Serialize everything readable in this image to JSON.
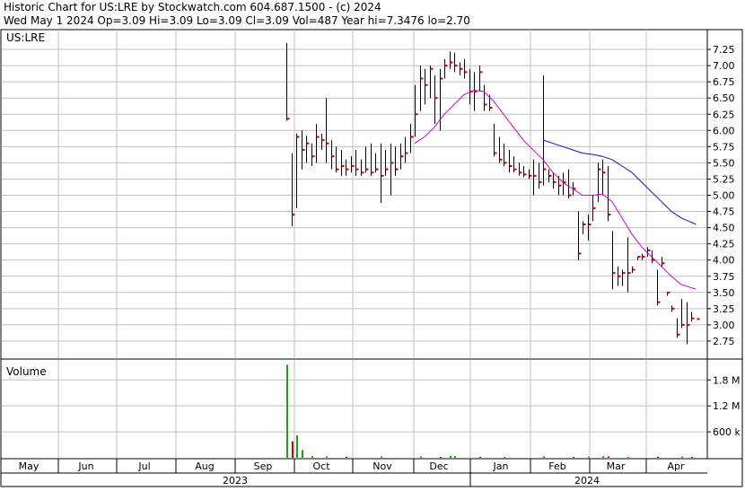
{
  "header": {
    "line1": "Historic Chart for US:LRE by Stockwatch.com 604.687.1500 - (c) 2024",
    "line2": "Wed May  1 2024  Op=3.09  Hi=3.09  Lo=3.09  Cl=3.09  Vol=487  Year hi=7.3476  lo=2.70"
  },
  "colors": {
    "price_bar": "#000000",
    "close_tick": "#cc0000",
    "ma_short": "#d000d0",
    "ma_long": "#1010c0",
    "volume_bar": "#11aa11",
    "volume_bar_down": "#cc0000",
    "grid": "#c0c0c0"
  },
  "chart_data": [
    {
      "type": "ohlc",
      "panel": "price",
      "label": "US:LRE",
      "y_ticks": [
        "7.25",
        "7.00",
        "6.75",
        "6.50",
        "6.25",
        "6.00",
        "5.75",
        "5.50",
        "5.25",
        "5.00",
        "4.75",
        "4.50",
        "4.25",
        "4.00",
        "3.75",
        "3.50",
        "3.25",
        "3.00",
        "2.75"
      ],
      "ylim": [
        2.5,
        7.5
      ],
      "x_months": [
        "May",
        "Jun",
        "Jul",
        "Aug",
        "Sep",
        "Oct",
        "Nov",
        "Dec",
        "Jan",
        "Feb",
        "Mar",
        "Apr"
      ],
      "x_years": [
        "2023",
        "2024"
      ],
      "grid": true,
      "bars": [
        {
          "x": 0,
          "h": 7.35,
          "l": 6.15,
          "c": 6.18
        },
        {
          "x": 1,
          "h": 5.65,
          "l": 4.52,
          "c": 4.7
        },
        {
          "x": 2,
          "h": 5.95,
          "l": 4.8,
          "c": 5.9
        },
        {
          "x": 3,
          "h": 6.0,
          "l": 5.4,
          "c": 5.7
        },
        {
          "x": 4,
          "h": 5.92,
          "l": 5.5,
          "c": 5.8
        },
        {
          "x": 5,
          "h": 5.8,
          "l": 5.45,
          "c": 5.6
        },
        {
          "x": 6,
          "h": 6.1,
          "l": 5.5,
          "c": 5.9
        },
        {
          "x": 7,
          "h": 5.95,
          "l": 5.7,
          "c": 5.85
        },
        {
          "x": 8,
          "h": 6.5,
          "l": 5.5,
          "c": 5.8
        },
        {
          "x": 9,
          "h": 5.85,
          "l": 5.4,
          "c": 5.6
        },
        {
          "x": 10,
          "h": 5.75,
          "l": 5.35,
          "c": 5.4
        },
        {
          "x": 11,
          "h": 5.7,
          "l": 5.3,
          "c": 5.45
        },
        {
          "x": 12,
          "h": 5.55,
          "l": 5.3,
          "c": 5.4
        },
        {
          "x": 13,
          "h": 5.6,
          "l": 5.35,
          "c": 5.45
        },
        {
          "x": 14,
          "h": 5.7,
          "l": 5.3,
          "c": 5.4
        },
        {
          "x": 15,
          "h": 5.55,
          "l": 5.3,
          "c": 5.35
        },
        {
          "x": 16,
          "h": 5.75,
          "l": 5.35,
          "c": 5.4
        },
        {
          "x": 17,
          "h": 5.8,
          "l": 5.3,
          "c": 5.35
        },
        {
          "x": 18,
          "h": 5.65,
          "l": 5.35,
          "c": 5.4
        },
        {
          "x": 19,
          "h": 5.8,
          "l": 4.88,
          "c": 5.3
        },
        {
          "x": 20,
          "h": 5.7,
          "l": 5.3,
          "c": 5.4
        },
        {
          "x": 21,
          "h": 5.8,
          "l": 5.0,
          "c": 5.5
        },
        {
          "x": 22,
          "h": 5.75,
          "l": 5.3,
          "c": 5.4
        },
        {
          "x": 23,
          "h": 5.8,
          "l": 5.4,
          "c": 5.6
        },
        {
          "x": 24,
          "h": 5.9,
          "l": 5.5,
          "c": 5.65
        },
        {
          "x": 25,
          "h": 6.1,
          "l": 5.65,
          "c": 5.9
        },
        {
          "x": 26,
          "h": 6.7,
          "l": 5.9,
          "c": 6.25
        },
        {
          "x": 27,
          "h": 7.0,
          "l": 6.3,
          "c": 6.8
        },
        {
          "x": 28,
          "h": 6.95,
          "l": 6.4,
          "c": 6.7
        },
        {
          "x": 29,
          "h": 7.0,
          "l": 6.5,
          "c": 6.95
        },
        {
          "x": 30,
          "h": 6.85,
          "l": 6.1,
          "c": 6.5
        },
        {
          "x": 31,
          "h": 6.95,
          "l": 6.0,
          "c": 6.8
        },
        {
          "x": 32,
          "h": 7.1,
          "l": 6.8,
          "c": 7.0
        },
        {
          "x": 33,
          "h": 7.22,
          "l": 6.95,
          "c": 7.05
        },
        {
          "x": 34,
          "h": 7.2,
          "l": 6.9,
          "c": 7.0
        },
        {
          "x": 35,
          "h": 7.05,
          "l": 6.85,
          "c": 6.95
        },
        {
          "x": 36,
          "h": 7.1,
          "l": 6.8,
          "c": 6.9
        },
        {
          "x": 37,
          "h": 6.95,
          "l": 6.4,
          "c": 6.6
        },
        {
          "x": 38,
          "h": 6.9,
          "l": 6.3,
          "c": 6.6
        },
        {
          "x": 39,
          "h": 7.0,
          "l": 6.6,
          "c": 6.9
        },
        {
          "x": 40,
          "h": 6.7,
          "l": 6.3,
          "c": 6.4
        },
        {
          "x": 41,
          "h": 6.55,
          "l": 6.3,
          "c": 6.35
        },
        {
          "x": 42,
          "h": 6.1,
          "l": 5.6,
          "c": 5.65
        },
        {
          "x": 43,
          "h": 5.9,
          "l": 5.5,
          "c": 5.55
        },
        {
          "x": 44,
          "h": 5.8,
          "l": 5.45,
          "c": 5.5
        },
        {
          "x": 45,
          "h": 5.7,
          "l": 5.35,
          "c": 5.45
        },
        {
          "x": 46,
          "h": 5.6,
          "l": 5.35,
          "c": 5.4
        },
        {
          "x": 47,
          "h": 5.5,
          "l": 5.3,
          "c": 5.35
        },
        {
          "x": 48,
          "h": 5.45,
          "l": 5.28,
          "c": 5.32
        },
        {
          "x": 49,
          "h": 5.4,
          "l": 5.25,
          "c": 5.3
        },
        {
          "x": 50,
          "h": 5.55,
          "l": 5.0,
          "c": 5.3
        },
        {
          "x": 51,
          "h": 5.5,
          "l": 5.1,
          "c": 5.2
        },
        {
          "x": 52,
          "h": 6.85,
          "l": 5.15,
          "c": 5.4
        },
        {
          "x": 53,
          "h": 5.4,
          "l": 5.2,
          "c": 5.3
        },
        {
          "x": 54,
          "h": 5.35,
          "l": 5.1,
          "c": 5.2
        },
        {
          "x": 55,
          "h": 5.3,
          "l": 5.0,
          "c": 5.15
        },
        {
          "x": 56,
          "h": 5.35,
          "l": 5.0,
          "c": 5.2
        },
        {
          "x": 57,
          "h": 5.4,
          "l": 4.95,
          "c": 5.0
        },
        {
          "x": 58,
          "h": 5.2,
          "l": 5.0,
          "c": 5.1
        },
        {
          "x": 59,
          "h": 4.75,
          "l": 4.0,
          "c": 4.1
        },
        {
          "x": 60,
          "h": 4.6,
          "l": 4.4,
          "c": 4.55
        },
        {
          "x": 61,
          "h": 4.7,
          "l": 4.3,
          "c": 4.55
        },
        {
          "x": 62,
          "h": 5.0,
          "l": 4.6,
          "c": 4.8
        },
        {
          "x": 63,
          "h": 5.5,
          "l": 4.9,
          "c": 5.4
        },
        {
          "x": 64,
          "h": 5.55,
          "l": 5.0,
          "c": 5.35
        },
        {
          "x": 65,
          "h": 5.45,
          "l": 4.6,
          "c": 4.7
        },
        {
          "x": 66,
          "h": 4.45,
          "l": 3.55,
          "c": 3.8
        },
        {
          "x": 67,
          "h": 3.9,
          "l": 3.6,
          "c": 3.75
        },
        {
          "x": 68,
          "h": 3.85,
          "l": 3.6,
          "c": 3.8
        },
        {
          "x": 69,
          "h": 4.35,
          "l": 3.5,
          "c": 3.8
        },
        {
          "x": 70,
          "h": 3.9,
          "l": 3.8,
          "c": 3.85
        },
        {
          "x": 71,
          "h": 4.05,
          "l": 4.0,
          "c": 4.05
        },
        {
          "x": 72,
          "h": 4.1,
          "l": 4.0,
          "c": 4.05
        },
        {
          "x": 73,
          "h": 4.2,
          "l": 4.05,
          "c": 4.15
        },
        {
          "x": 74,
          "h": 4.15,
          "l": 3.95,
          "c": 4.0
        },
        {
          "x": 75,
          "h": 3.85,
          "l": 3.3,
          "c": 3.35
        },
        {
          "x": 76,
          "h": 4.05,
          "l": 3.9,
          "c": 3.95
        },
        {
          "x": 77,
          "h": 3.5,
          "l": 3.45,
          "c": 3.5
        },
        {
          "x": 78,
          "h": 3.3,
          "l": 3.2,
          "c": 3.25
        },
        {
          "x": 79,
          "h": 3.1,
          "l": 2.8,
          "c": 2.85
        },
        {
          "x": 80,
          "h": 3.4,
          "l": 2.95,
          "c": 3.0
        },
        {
          "x": 81,
          "h": 3.35,
          "l": 2.7,
          "c": 3.0
        },
        {
          "x": 82,
          "h": 3.2,
          "l": 3.05,
          "c": 3.1
        },
        {
          "x": 83,
          "h": 3.09,
          "l": 3.09,
          "c": 3.09
        }
      ],
      "ma_short": [
        [
          26,
          5.8
        ],
        [
          28,
          5.9
        ],
        [
          30,
          6.05
        ],
        [
          32,
          6.25
        ],
        [
          34,
          6.4
        ],
        [
          36,
          6.55
        ],
        [
          38,
          6.62
        ],
        [
          40,
          6.6
        ],
        [
          42,
          6.45
        ],
        [
          44,
          6.25
        ],
        [
          46,
          6.05
        ],
        [
          48,
          5.85
        ],
        [
          50,
          5.7
        ],
        [
          52,
          5.55
        ],
        [
          54,
          5.35
        ],
        [
          56,
          5.2
        ],
        [
          58,
          5.1
        ],
        [
          60,
          5.0
        ],
        [
          62,
          5.0
        ],
        [
          64,
          5.02
        ],
        [
          66,
          4.9
        ],
        [
          68,
          4.65
        ],
        [
          70,
          4.4
        ],
        [
          72,
          4.2
        ],
        [
          74,
          4.05
        ],
        [
          76,
          3.9
        ],
        [
          78,
          3.75
        ],
        [
          80,
          3.62
        ],
        [
          83,
          3.55
        ]
      ],
      "ma_long": [
        [
          52,
          5.85
        ],
        [
          54,
          5.8
        ],
        [
          56,
          5.75
        ],
        [
          58,
          5.7
        ],
        [
          60,
          5.65
        ],
        [
          62,
          5.63
        ],
        [
          64,
          5.6
        ],
        [
          66,
          5.55
        ],
        [
          68,
          5.45
        ],
        [
          70,
          5.35
        ],
        [
          72,
          5.2
        ],
        [
          74,
          5.05
        ],
        [
          76,
          4.9
        ],
        [
          78,
          4.75
        ],
        [
          80,
          4.65
        ],
        [
          83,
          4.55
        ]
      ]
    },
    {
      "type": "bar",
      "panel": "volume",
      "label": "Volume",
      "y_ticks": [
        "1.8 M",
        "1.2 M",
        "600 k"
      ],
      "ylim": [
        0,
        2200000
      ],
      "bars": [
        {
          "x": 0,
          "v": 2150000,
          "up": true
        },
        {
          "x": 1,
          "v": 380000,
          "up": false
        },
        {
          "x": 2,
          "v": 520000,
          "up": true
        },
        {
          "x": 3,
          "v": 180000,
          "up": true
        },
        {
          "x": 5,
          "v": 40000,
          "up": true
        },
        {
          "x": 8,
          "v": 30000,
          "up": true
        },
        {
          "x": 12,
          "v": 25000,
          "up": false
        },
        {
          "x": 19,
          "v": 30000,
          "up": true
        },
        {
          "x": 27,
          "v": 30000,
          "up": true
        },
        {
          "x": 31,
          "v": 20000,
          "up": false
        },
        {
          "x": 33,
          "v": 50000,
          "up": true
        },
        {
          "x": 34,
          "v": 40000,
          "up": true
        },
        {
          "x": 39,
          "v": 25000,
          "up": false
        },
        {
          "x": 44,
          "v": 20000,
          "up": true
        },
        {
          "x": 52,
          "v": 30000,
          "up": true
        },
        {
          "x": 58,
          "v": 20000,
          "up": false
        },
        {
          "x": 61,
          "v": 25000,
          "up": true
        },
        {
          "x": 64,
          "v": 35000,
          "up": true
        },
        {
          "x": 65,
          "v": 30000,
          "up": false
        },
        {
          "x": 69,
          "v": 20000,
          "up": true
        },
        {
          "x": 75,
          "v": 25000,
          "up": false
        },
        {
          "x": 80,
          "v": 30000,
          "up": true
        },
        {
          "x": 82,
          "v": 20000,
          "up": false
        }
      ]
    }
  ]
}
